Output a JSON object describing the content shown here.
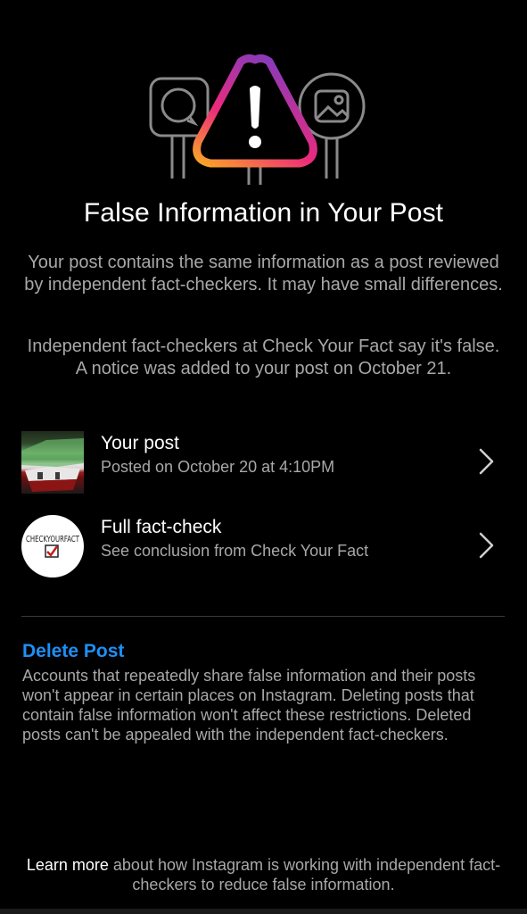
{
  "title": "False Information in Your Post",
  "paragraph1": "Your post contains the same information as a post reviewed by independent fact-checkers. It may have small differences.",
  "paragraph2": "Independent fact-checkers at Check Your Fact say it's false.  A notice was added to your post on October 21.",
  "items": [
    {
      "title": "Your post",
      "subtitle": "Posted on October 20 at 4:10PM",
      "icon": "chevron-right-icon"
    },
    {
      "title": "Full fact-check",
      "subtitle": "See conclusion from Check Your Fact",
      "icon": "chevron-right-icon",
      "thumb_text": "CHECKYOURFACT"
    }
  ],
  "delete": {
    "label": "Delete Post",
    "description": "Accounts that repeatedly share false information and their posts won't appear in certain places on Instagram. Deleting posts that contain false information won't affect these restrictions. Deleted posts can't be appealed with the independent fact-checkers."
  },
  "footer": {
    "link": "Learn more",
    "text": " about how Instagram is working with independent fact-checkers to reduce false information."
  },
  "colors": {
    "background": "#000000",
    "link_blue": "#1e8ff5",
    "secondary_text": "#a8a8a8",
    "warning_gradient": [
      "#f9a825",
      "#e1306c",
      "#833ab4"
    ]
  },
  "hero_icons": [
    "chat-bubble-sign-icon",
    "warning-triangle-icon",
    "image-sign-icon"
  ]
}
